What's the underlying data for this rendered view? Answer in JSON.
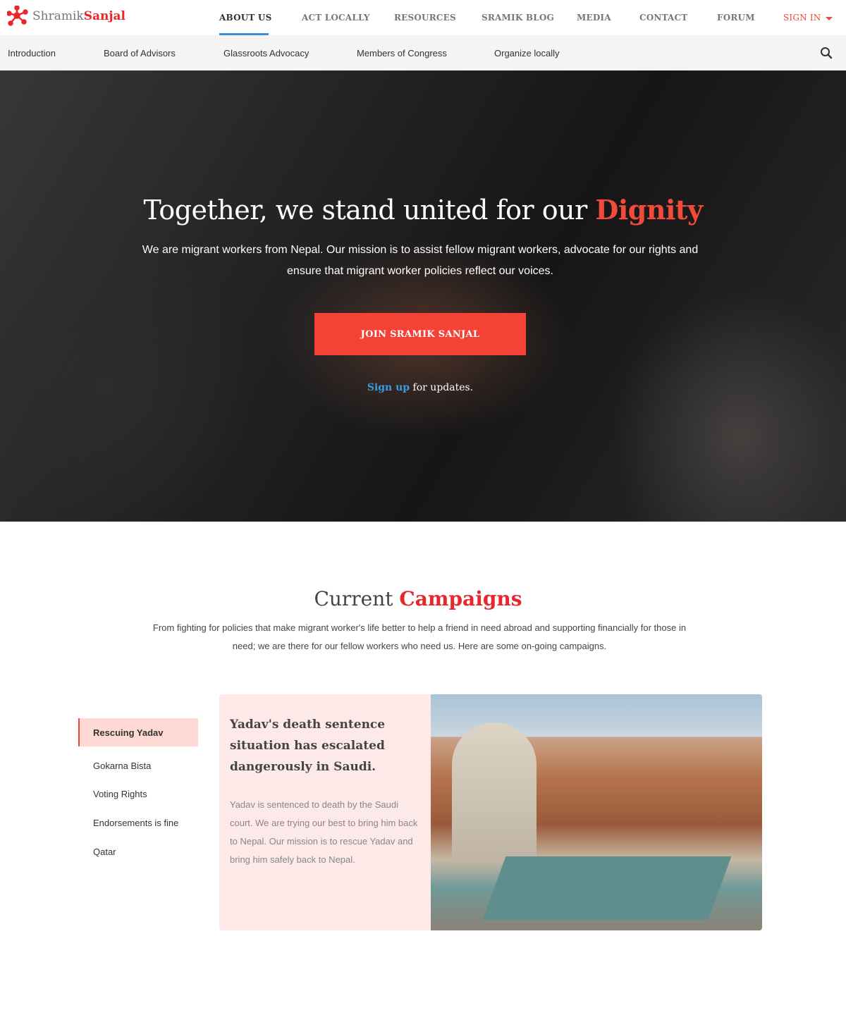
{
  "brand": {
    "name_part1": "Shramik",
    "name_part2": "Sanjal",
    "accent": "#e8262b"
  },
  "nav": {
    "items": [
      "ABOUT US",
      "ACT LOCALLY",
      "RESOURCES",
      "SRAMIK BLOG",
      "MEDIA",
      "CONTACT",
      "FORUM"
    ],
    "active": "ABOUT US",
    "signin": "SIGN IN"
  },
  "subnav": {
    "items": [
      "Introduction",
      "Board of Advisors",
      "Glassroots Advocacy",
      "Members of Congress",
      "Organize locally"
    ]
  },
  "hero": {
    "title_prefix": "Together, we stand united for our ",
    "title_highlight": "Dignity",
    "text": "We are migrant workers from Nepal. Our mission is to assist fellow migrant workers, advocate for our rights and ensure that migrant worker policies reflect our voices.",
    "cta": "JOIN SRAMIK SANJAL",
    "signup_link": "Sign up",
    "signup_rest": " for updates."
  },
  "campaigns": {
    "title_prefix": "Current ",
    "title_highlight": "Campaigns",
    "description": "From fighting for policies that make migrant worker's life better to help a friend in need abroad and supporting financially for those in need; we are there for our fellow workers who need us. Here are some on-going campaigns.",
    "tabs": [
      "Rescuing Yadav",
      "Gokarna Bista",
      "Voting Rights",
      "Endorsements is fine",
      "Qatar"
    ],
    "active_tab": "Rescuing Yadav",
    "card": {
      "heading": "Yadav's death sentence situation has escalated dangerously in Saudi.",
      "body": "Yadav is sentenced to death by the Saudi court. We are trying our best to bring him back to Nepal. Our mission is to rescue Yadav and bring him safely back to Nepal."
    }
  }
}
